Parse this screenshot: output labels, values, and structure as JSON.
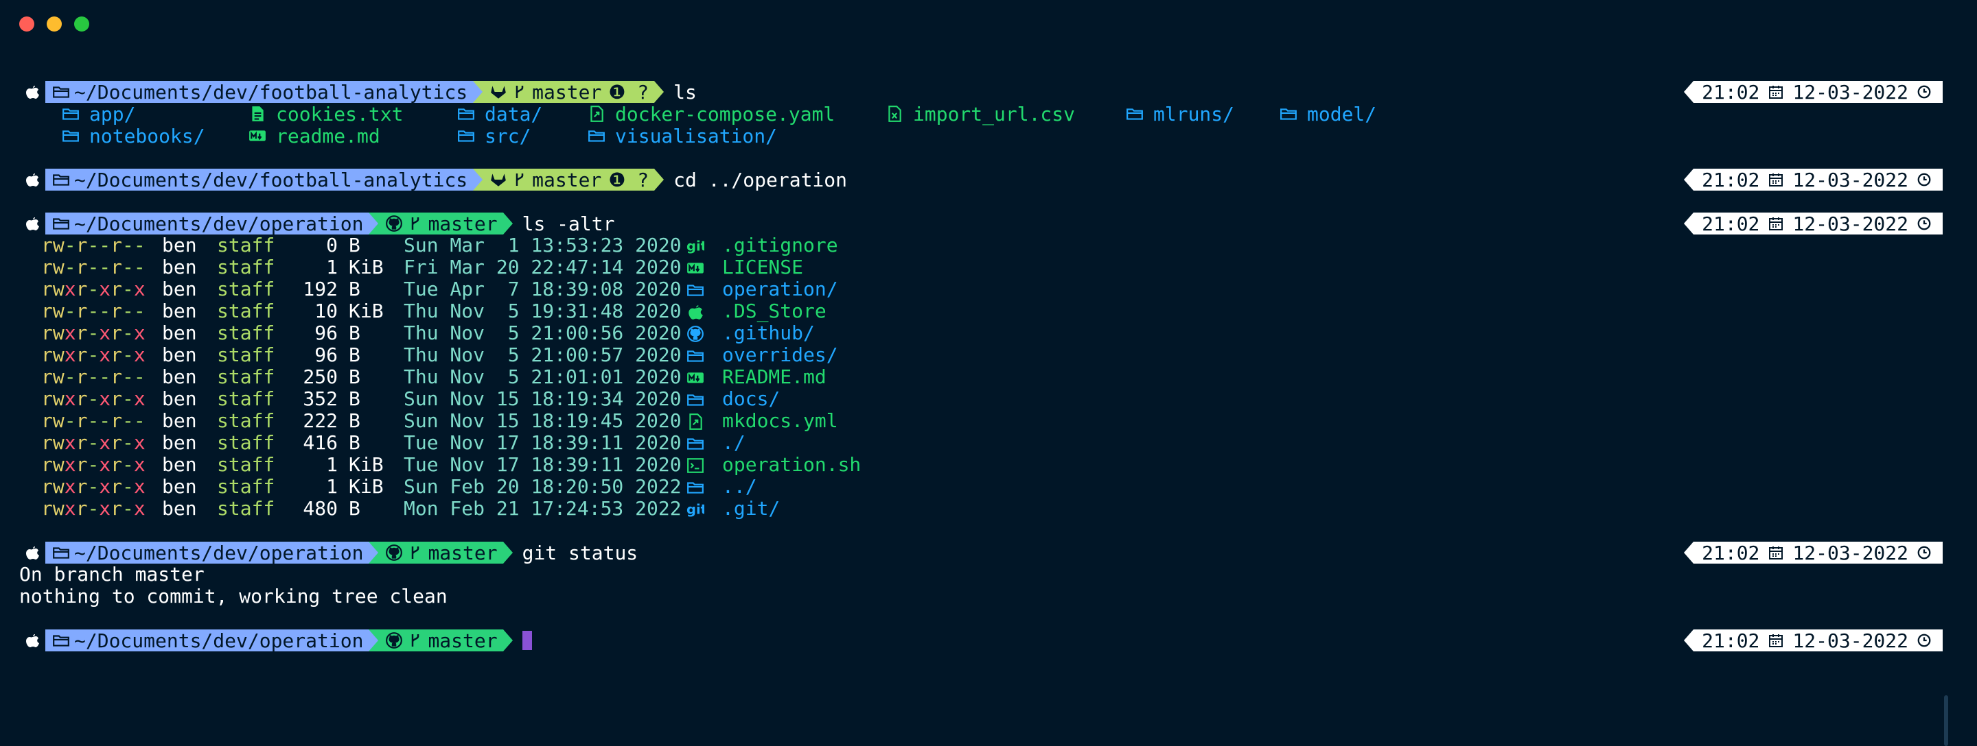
{
  "window": {
    "traffic_lights": [
      "#ff5f57",
      "#febc2e",
      "#28c840"
    ]
  },
  "colors": {
    "path_bg": "#82aaff",
    "gitlab_bg": "#addb67",
    "github_bg": "#2ad27a",
    "dir": "#21a7ff",
    "file": "#22da6e",
    "user": "#ffffff",
    "group": "#addb67",
    "date": "#7fdbca"
  },
  "prompts": [
    {
      "path": "~/Documents/dev/football-analytics",
      "vcs_icon": "gitlab-icon",
      "branch": "master",
      "status": "❶ ?",
      "command": "ls",
      "time": "21:02",
      "date": "12-03-2022"
    },
    {
      "path": "~/Documents/dev/football-analytics",
      "vcs_icon": "gitlab-icon",
      "branch": "master",
      "status": "❶ ?",
      "command": "cd ../operation",
      "time": "21:02",
      "date": "12-03-2022"
    },
    {
      "path": "~/Documents/dev/operation",
      "vcs_icon": "github-icon",
      "branch": "master",
      "status": "",
      "command": "ls -altr",
      "time": "21:02",
      "date": "12-03-2022"
    },
    {
      "path": "~/Documents/dev/operation",
      "vcs_icon": "github-icon",
      "branch": "master",
      "status": "",
      "command": "git status",
      "time": "21:02",
      "date": "12-03-2022"
    },
    {
      "path": "~/Documents/dev/operation",
      "vcs_icon": "github-icon",
      "branch": "master",
      "status": "",
      "command": "",
      "time": "21:02",
      "date": "12-03-2022"
    }
  ],
  "ls_output": [
    {
      "name": "app/",
      "icon": "folder-icon",
      "kind": "dir"
    },
    {
      "name": "cookies.txt",
      "icon": "file-text-icon",
      "kind": "file"
    },
    {
      "name": "data/",
      "icon": "folder-icon",
      "kind": "dir"
    },
    {
      "name": "docker-compose.yaml",
      "icon": "file-link-icon",
      "kind": "file"
    },
    {
      "name": "import_url.csv",
      "icon": "file-excel-icon",
      "kind": "file"
    },
    {
      "name": "mlruns/",
      "icon": "folder-icon",
      "kind": "dir"
    },
    {
      "name": "model/",
      "icon": "folder-icon",
      "kind": "dir"
    },
    {
      "name": "notebooks/",
      "icon": "folder-icon",
      "kind": "dir"
    },
    {
      "name": "readme.md",
      "icon": "markdown-icon",
      "kind": "file"
    },
    {
      "name": "src/",
      "icon": "folder-icon",
      "kind": "dir"
    },
    {
      "name": "visualisation/",
      "icon": "folder-icon",
      "kind": "dir"
    }
  ],
  "ls_altr": [
    {
      "perms": "rw-r--r--",
      "user": "ben",
      "group": "staff",
      "size": "0",
      "unit": "B",
      "date": "Sun Mar  1 13:53:23 2020",
      "icon": "git-icon",
      "name": ".gitignore",
      "kind": "file"
    },
    {
      "perms": "rw-r--r--",
      "user": "ben",
      "group": "staff",
      "size": "1",
      "unit": "KiB",
      "date": "Fri Mar 20 22:47:14 2020",
      "icon": "markdown-icon",
      "name": "LICENSE",
      "kind": "file"
    },
    {
      "perms": "rwxr-xr-x",
      "user": "ben",
      "group": "staff",
      "size": "192",
      "unit": "B",
      "date": "Tue Apr  7 18:39:08 2020",
      "icon": "folder-icon",
      "name": "operation/",
      "kind": "dir"
    },
    {
      "perms": "rw-r--r--",
      "user": "ben",
      "group": "staff",
      "size": "10",
      "unit": "KiB",
      "date": "Thu Nov  5 19:31:48 2020",
      "icon": "apple-icon",
      "name": ".DS_Store",
      "kind": "file"
    },
    {
      "perms": "rwxr-xr-x",
      "user": "ben",
      "group": "staff",
      "size": "96",
      "unit": "B",
      "date": "Thu Nov  5 21:00:56 2020",
      "icon": "github-icon",
      "name": ".github/",
      "kind": "dir"
    },
    {
      "perms": "rwxr-xr-x",
      "user": "ben",
      "group": "staff",
      "size": "96",
      "unit": "B",
      "date": "Thu Nov  5 21:00:57 2020",
      "icon": "folder-icon",
      "name": "overrides/",
      "kind": "dir"
    },
    {
      "perms": "rw-r--r--",
      "user": "ben",
      "group": "staff",
      "size": "250",
      "unit": "B",
      "date": "Thu Nov  5 21:01:01 2020",
      "icon": "markdown-icon",
      "name": "README.md",
      "kind": "file"
    },
    {
      "perms": "rwxr-xr-x",
      "user": "ben",
      "group": "staff",
      "size": "352",
      "unit": "B",
      "date": "Sun Nov 15 18:19:34 2020",
      "icon": "folder-icon",
      "name": "docs/",
      "kind": "dir"
    },
    {
      "perms": "rw-r--r--",
      "user": "ben",
      "group": "staff",
      "size": "222",
      "unit": "B",
      "date": "Sun Nov 15 18:19:45 2020",
      "icon": "file-link-icon",
      "name": "mkdocs.yml",
      "kind": "file"
    },
    {
      "perms": "rwxr-xr-x",
      "user": "ben",
      "group": "staff",
      "size": "416",
      "unit": "B",
      "date": "Tue Nov 17 18:39:11 2020",
      "icon": "folder-icon",
      "name": "./",
      "kind": "dir"
    },
    {
      "perms": "rwxr-xr-x",
      "user": "ben",
      "group": "staff",
      "size": "1",
      "unit": "KiB",
      "date": "Tue Nov 17 18:39:11 2020",
      "icon": "terminal-icon",
      "name": "operation.sh",
      "kind": "file"
    },
    {
      "perms": "rwxr-xr-x",
      "user": "ben",
      "group": "staff",
      "size": "1",
      "unit": "KiB",
      "date": "Sun Feb 20 18:20:50 2022",
      "icon": "folder-icon",
      "name": "../",
      "kind": "dir"
    },
    {
      "perms": "rwxr-xr-x",
      "user": "ben",
      "group": "staff",
      "size": "480",
      "unit": "B",
      "date": "Mon Feb 21 17:24:53 2022",
      "icon": "git-icon",
      "name": ".git/",
      "kind": "dir"
    }
  ],
  "git_status_output": [
    "On branch master",
    "nothing to commit, working tree clean"
  ]
}
